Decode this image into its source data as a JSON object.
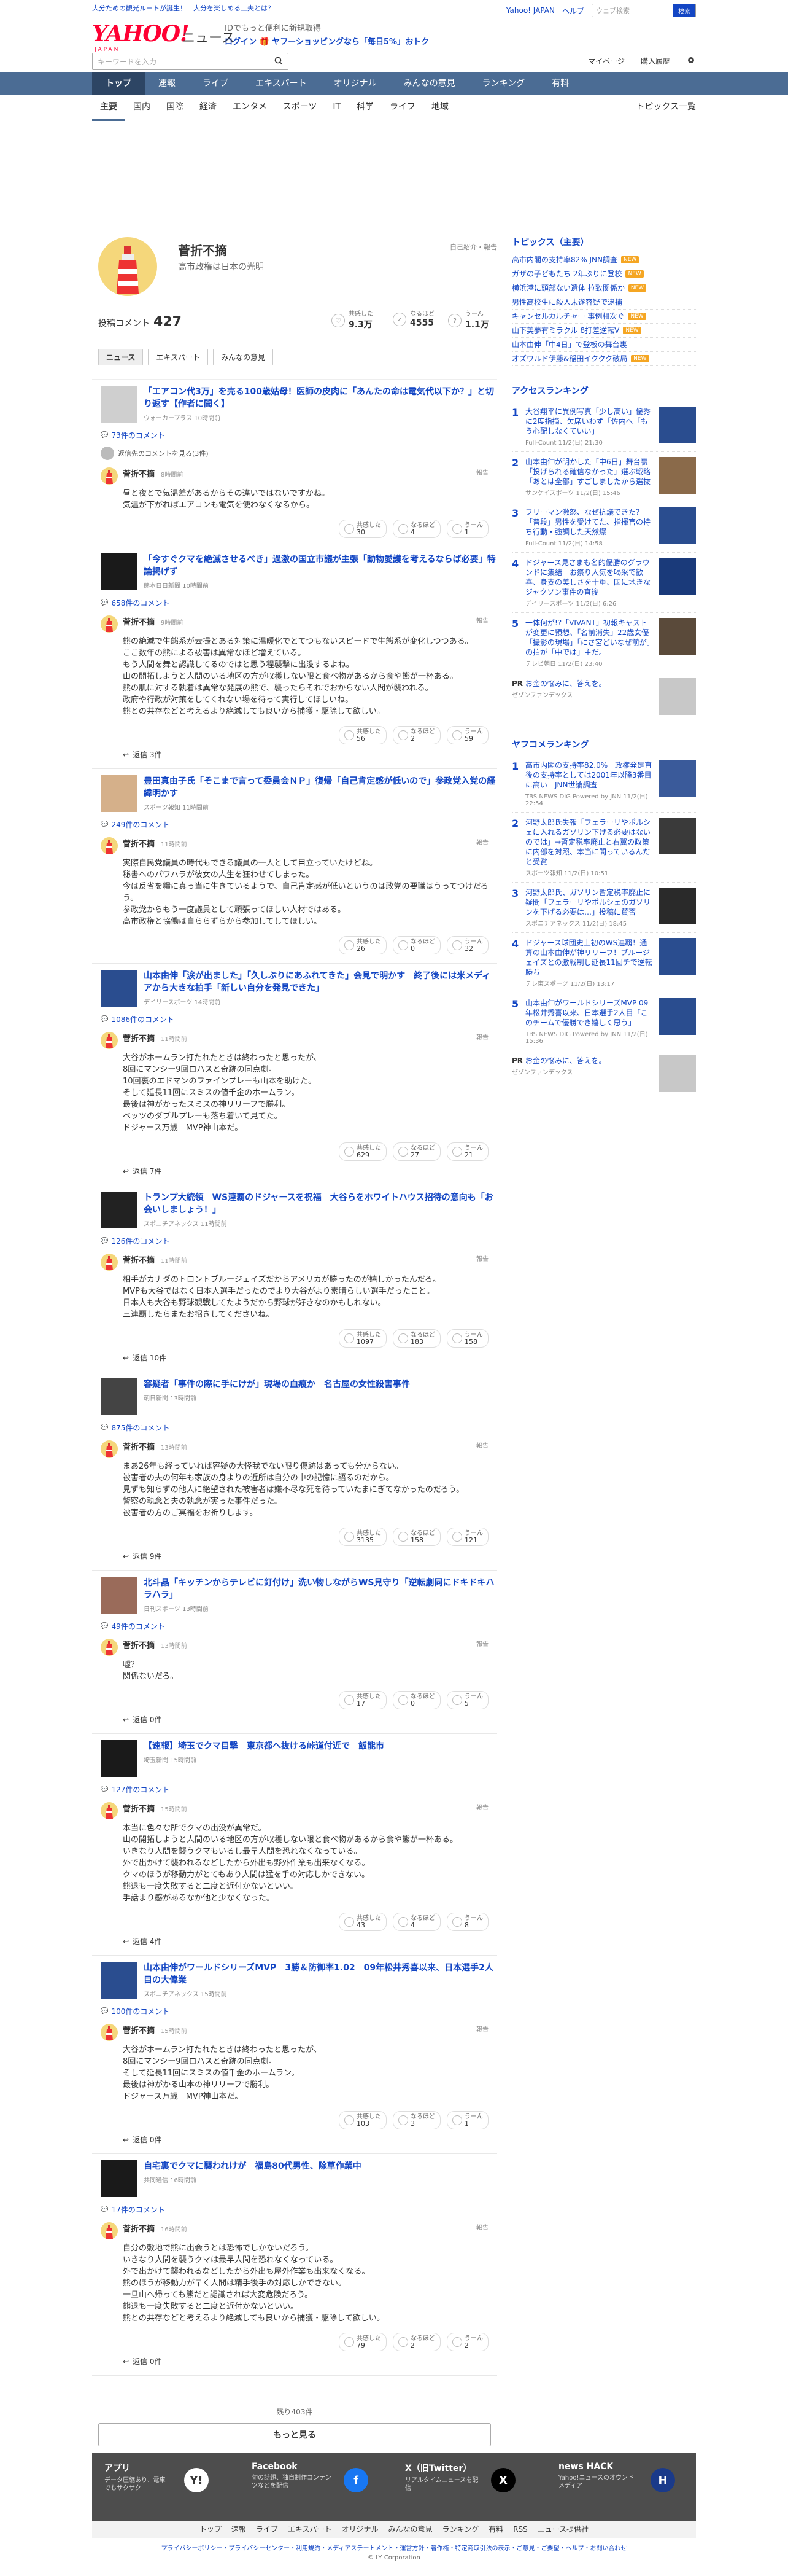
{
  "top_strip": {
    "left": "大分ための観光ルートが誕生！　大分を楽しめる工夫とは？",
    "right_links": [
      "Yahoo! JAPAN",
      "ヘルプ"
    ],
    "search_placeholder": "ウェブ検索",
    "search_button": "検索"
  },
  "masthead": {
    "logo": "YAHOO!",
    "logo_sub": "JAPAN",
    "section": "ニュース",
    "promo_line1": "IDでもっと便利に新規取得",
    "promo_line2": "ログイン 🎁 ヤフーショッピングなら「毎日5%」おトク"
  },
  "search": {
    "placeholder": "キーワードを入力",
    "mypage": "マイページ",
    "history": "購入履歴"
  },
  "global_nav": [
    "トップ",
    "速報",
    "ライブ",
    "エキスパート",
    "オリジナル",
    "みんなの意見",
    "ランキング",
    "有料"
  ],
  "category_nav": [
    "主要",
    "国内",
    "国際",
    "経済",
    "エンタメ",
    "スポーツ",
    "IT",
    "科学",
    "ライフ",
    "地域"
  ],
  "category_nav_right": "トピックス一覧",
  "profile": {
    "name": "菅折不摘",
    "bio": "高市政権は日本の光明",
    "note": "自己紹介・報告",
    "post_count_label": "投稿コメント",
    "post_count": "427",
    "stats": [
      {
        "label": "共感した",
        "value": "9.3万",
        "icon": "♡"
      },
      {
        "label": "なるほど",
        "value": "4555",
        "icon": "✓"
      },
      {
        "label": "うーん",
        "value": "1.1万",
        "icon": "?"
      }
    ],
    "tabs": [
      "ニュース",
      "エキスパート",
      "みんなの意見"
    ]
  },
  "entries": [
    {
      "title": "「エアコン代3万」を売る100歳姑母！医師の皮肉に「あんたの命は電気代以下か？」と切り返す【作者に聞く】",
      "source": "ウォーカープラス 10時間前",
      "comment_count": "73件のコメント",
      "reply_note": "返信先のコメントを見る(3件)",
      "user": "菅折不摘",
      "time": "8時間前",
      "body": "昼と夜とで気温差があるからその違いではないですかね。\n気温が下がればエアコンも電気を使わなくなるから。",
      "empathy": "30",
      "naruhodo": "4",
      "uun": "1",
      "replies": null,
      "thumb": "#cfcfcf"
    },
    {
      "title": "「今すぐクマを絶滅させるべき」過激の国立市議が主張「動物愛護を考えるならば必要」特論掲げず",
      "source": "熊本日日新聞 10時間前",
      "comment_count": "658件のコメント",
      "reply_note": "",
      "user": "菅折不摘",
      "time": "9時間前",
      "body": "熊の絶滅で生態系が云撮とある対策に温暖化でとてつもないスピードで生態系が変化しつつある。\nここ数年の熊による被害は異常なほど増えている。\nもう人間を舞と認識してるのではと思う程襲撃に出没するよね。\n山の開拓しようと人間のいる地区の方が収穫しない限と食べ物があるから食や熊が一杯ある。\n熊の肌に対する執着は異常な発展の熊で、襲ったらそれでおからない人間が襲われる。\n政府や行政が対策をしてくれない場を待って実行してほしいね。\n熊との共存などと考えるより絶滅しても良いから捕獲・駆除して欲しい。",
      "empathy": "56",
      "naruhodo": "2",
      "uun": "59",
      "replies": "返信 3件",
      "thumb": "#1a1a1a"
    },
    {
      "title": "豊田真由子氏「そこまで言って委員会ＮＰ」復帰「自己肯定感が低いので」参政党入党の経緯明かす",
      "source": "スポーツ報知 11時間前",
      "comment_count": "249件のコメント",
      "reply_note": "",
      "user": "菅折不摘",
      "time": "11時間前",
      "body": "実際自民党議員の時代もできる議員の一人として目立っていたけどね。\n秘書へのパワハラが彼女の人生を狂わせてしまった。\n今は反省を糧に真っ当に生きているようで、自己肯定感が低いというのは政党の要職はうってつけだろう。\n参政党からもう一度議員として頑張ってほしい人材ではある。\n高市政権と協働は自ららずらから参加してしてほしい。",
      "empathy": "26",
      "naruhodo": "0",
      "uun": "32",
      "replies": null,
      "thumb": "#d5b08a"
    },
    {
      "title": "山本由伸「涙が出ました」「久しぶりにあふれてきた」会見で明かす　終了後には米メディアから大きな拍手「新しい自分を発見できた」",
      "source": "デイリースポーツ 14時間前",
      "comment_count": "1086件のコメント",
      "reply_note": "",
      "user": "菅折不摘",
      "time": "11時間前",
      "body": "大谷がホームラン打たれたときは終わったと思ったが、\n8回にマンシー9回ロハスと奇跡の同点劇。\n10回裏のエドマンのファインプレーも山本を助けた。\nそして延長11回にスミスの値千金のホームラン。\n最後は神がかったスミスの神リリーフで勝利。\nベッツのダブルプレーも落ち着いて見てた。\nドジャース万歳　MVP神山本だ。",
      "empathy": "629",
      "naruhodo": "27",
      "uun": "21",
      "replies": "返信 7件",
      "thumb": "#2a4d8f"
    },
    {
      "title": "トランプ大統領　WS連覇のドジャースを祝福　大谷らをホワイトハウス招待の意向も「お会いしましょう！」",
      "source": "スポニチアネックス 11時間前",
      "comment_count": "126件のコメント",
      "reply_note": "",
      "user": "菅折不摘",
      "time": "11時間前",
      "body": "相手がカナダのトロントブルージェイズだからアメリカが勝ったのが嬉しかったんだろ。\nMVPも大谷ではなく日本人選手だったのでより大谷がより素晴らしい選手だったこと。\n日本人も大谷も野球観戦してたようだから野球が好きなのかもしれない。\n三連覇したらまたお招きしてくださいね。",
      "empathy": "1097",
      "naruhodo": "183",
      "uun": "158",
      "replies": "返信 10件",
      "thumb": "#222222"
    },
    {
      "title": "容疑者「事件の際に手にけが」現場の血痕か　名古屋の女性殺害事件",
      "source": "朝日新聞 13時間前",
      "comment_count": "875件のコメント",
      "reply_note": "",
      "user": "菅折不摘",
      "time": "13時間前",
      "body": "まあ26年も経っていれば容疑の大怪我でない限り傷跡はあっても分からない。\n被害者の夫の何年も家族の身よりの近所は自分の中の記憶に語るのだから。\n見ずも知らずの他人に絶望された被害者は嫌不尽な死を待っていたまにぎてなかったのだろう。\n警察の執念と夫の執念が実った事件だった。\n被害者の方のご冥福をお祈りします。",
      "empathy": "3135",
      "naruhodo": "158",
      "uun": "121",
      "replies": "返信 9件",
      "thumb": "#444444"
    },
    {
      "title": "北斗晶「キッチンからテレビに釘付け」洗い物しながらWS見守り「逆転劇同にドキドキハラハラ」",
      "source": "日刊スポーツ 13時間前",
      "comment_count": "49件のコメント",
      "reply_note": "",
      "user": "菅折不摘",
      "time": "13時間前",
      "body": "嘘？\n関係ないだろ。",
      "empathy": "17",
      "naruhodo": "0",
      "uun": "5",
      "replies": "返信 0件",
      "thumb": "#9a6b5a"
    },
    {
      "title": "【速報】埼玉でクマ目撃　東京都へ抜ける峠道付近で　飯能市",
      "source": "埼玉新聞 15時間前",
      "comment_count": "127件のコメント",
      "reply_note": "",
      "user": "菅折不摘",
      "time": "15時間前",
      "body": "本当に色々な所でクマの出没が異常だ。\n山の開拓しようと人間のいる地区の方が収穫しない限と食べ物があるから食や熊が一杯ある。\nいきなり人間を襲うクマもいるし最早人間を恐れなくなっている。\n外で出かけて襲われるなどしたから外出も野外作業も出来なくなる。\nクマのほうが移動力がとてもあり人間は猛を手の対応しかできない。\n熊退も一度失敗すると二度と近付かないといい。\n手話まり感があるなか他と少なくなった。",
      "empathy": "43",
      "naruhodo": "4",
      "uun": "8",
      "replies": "返信 4件",
      "thumb": "#1a1a1a"
    },
    {
      "title": "山本由伸がワールドシリーズMVP　3勝＆防御率1.02　09年松井秀喜以来、日本選手2人目の大偉業",
      "source": "スポニチアネックス 15時間前",
      "comment_count": "100件のコメント",
      "reply_note": "",
      "user": "菅折不摘",
      "time": "15時間前",
      "body": "大谷がホームラン打たれたときは終わったと思ったが、\n8回にマンシー9回ロハスと奇跡の同点劇。\nそして延長11回にスミスの値千金のホームラン。\n最後は神がかる山本の神リリーフで勝利。\nドジャース万歳　MVP神山本だ。",
      "empathy": "103",
      "naruhodo": "3",
      "uun": "1",
      "replies": "返信 0件",
      "thumb": "#2a4d8f"
    },
    {
      "title": "自宅裏でクマに襲われけが　福島80代男性、除草作業中",
      "source": "共同通信 16時間前",
      "comment_count": "17件のコメント",
      "reply_note": "",
      "user": "菅折不摘",
      "time": "16時間前",
      "body": "自分の敷地で熊に出会うとは恐怖でしかないだろう。\nいきなり人間を襲うクマは最早人間を恐れなくなっている。\n外で出かけて襲われるなどしたから外出も屋外作業も出来なくなる。\n熊のほうが移動力が早く人間は精手後手の対応しかできない。\n一旦山へ帰っても熊だと認識されば大変危険だろう。\n熊退も一度失敗すると二度と近付かないといい。\n熊との共存などと考えるより絶滅しても良いから捕獲・駆除して欲しい。",
      "empathy": "79",
      "naruhodo": "2",
      "uun": "2",
      "replies": "返信 0件",
      "thumb": "#1a1a1a"
    }
  ],
  "more": {
    "remaining": "残り403件",
    "button": "もっと見る"
  },
  "side": {
    "topics_heading": "トピックス（主要）",
    "topics": [
      {
        "t": "高市内閣の支持率82% JNN調査",
        "b": "NEW"
      },
      {
        "t": "ガザの子どもたち 2年ぶりに登校",
        "b": "NEW"
      },
      {
        "t": "横浜港に頭部ない遺体 拉致関係か",
        "b": "NEW"
      },
      {
        "t": "男性高校生に殺人未遂容疑で逮捕",
        "b": ""
      },
      {
        "t": "キャンセルカルチャー 事例相次ぐ",
        "b": "NEW"
      },
      {
        "t": "山下美夢有ミラクル 8打差逆転V",
        "b": "NEW"
      },
      {
        "t": "山本由伸「中4日」で登板の舞台裏",
        "b": ""
      },
      {
        "t": "オズワルド伊藤&稲田イククク破局",
        "b": "NEW"
      }
    ],
    "access_heading": "アクセスランキング",
    "access": [
      {
        "n": "1",
        "t": "大谷翔平に異例写真「少し高い」優秀に2度指摘、欠席いわず「佐内へ「もう心配しなくていい」",
        "s": "Full-Count 11/2(日) 21:30",
        "img": "#2a4d8f"
      },
      {
        "n": "2",
        "t": "山本由伸が明かした「中6日」舞台裏「投げられる確信なかった」選ぶ戦略「あとは全部」すごしましたから選抜",
        "s": "サンケイスポーツ 11/2(日) 15:46",
        "img": "#8a6a4a"
      },
      {
        "n": "3",
        "t": "フリーマン激怒、なぜ抗議できた？「普段」男性を受けてた、指揮官の持ち行動・強調した天然爆",
        "s": "Full-Count 11/2(日) 14:58",
        "img": "#2a4d8f"
      },
      {
        "n": "4",
        "t": "ドジャース見さまも名的優勝のグラウンドに集結　お祭り人気を喝采で歓喜、身支の美しさを十重、国に地きなジャクソン事件の直後",
        "s": "デイリースポーツ 11/2(日) 6:26",
        "img": "#1a3a7a"
      },
      {
        "n": "5",
        "t": "一体何が!?「VIVANT」初報キャストが変更に預想、「名前消失」22歳女優「撮影の現場」「にさ宮どいなぜ前が」の拍が「中では」主だ。",
        "s": "テレビ朝日 11/2(日) 23:40",
        "img": "#5a4a3a"
      }
    ],
    "pr1_tag": "PR",
    "pr1_text": "お金の悩みに、答えを。",
    "pr1_src": "ゼゾンファンデックス",
    "yahoo_heading": "ヤフコメランキング",
    "yahoo": [
      {
        "n": "1",
        "t": "高市内閣の支持率82.0%　政権発足直後の支持率としては2001年以降3番目に高い　JNN世論調査",
        "s": "TBS NEWS DIG Powered by JNN 11/2(日) 22:54",
        "img": "#3a5a9a"
      },
      {
        "n": "2",
        "t": "河野太郎氏失報「フェラーリやポルシェに入れるガソリン下げる必要はないのでは」→暫定税率廃止と右翼の政策に内部を対照、本当に問っているんだと受賞",
        "s": "スポーツ報知 11/2(日) 10:51",
        "img": "#3a3a3a"
      },
      {
        "n": "3",
        "t": "河野太郎氏、ガソリン暫定税率廃止に疑問「フェラーリやポルシェのガソリンを下げる必要は…」投稿に賛否",
        "s": "スポニチアネックス 11/2(日) 18:45",
        "img": "#2a2a2a"
      },
      {
        "n": "4",
        "t": "ドジャース球団史上初のWS連覇！通算の山本由伸が神リリーフ！ブルージェイズとの激戦制し延長11回チで逆転勝ち",
        "s": "テレ東スポーツ 11/2(日) 13:17",
        "img": "#2a4d8f"
      },
      {
        "n": "5",
        "t": "山本由伸がワールドシリーズMVP 09年松井秀喜以来、日本選手2人目「このチームで優勝でき嬉しく思う」",
        "s": "TBS NEWS DIG Powered by JNN 11/2(日) 15:36",
        "img": "#2a4d8f"
      }
    ],
    "pr2_tag": "PR",
    "pr2_text": "お金の悩みに、答えを。",
    "pr2_src": "ゼゾンファンデックス"
  },
  "footer": {
    "apps": [
      {
        "h": "アプリ",
        "p": "データ圧縮あり、電車でもサクサク",
        "icon": "Y!"
      },
      {
        "h": "Facebook",
        "p": "旬の話題、独自制作コンテンツなどを配信",
        "icon": "f"
      },
      {
        "h": "X（旧Twitter）",
        "p": "リアルタイムニュースを配信",
        "icon": "X"
      },
      {
        "h": "news HACK",
        "p": "Yahoo!ニュースのオウンドメディア",
        "icon": "H"
      }
    ],
    "nav": [
      "トップ",
      "速報",
      "ライブ",
      "エキスパート",
      "オリジナル",
      "みんなの意見",
      "ランキング",
      "有料",
      "RSS",
      "ニュース提供社"
    ],
    "legal": "プライバシーポリシー・プライバシーセンター・利用規約・メディアステートメント・運営方針・著作権・特定商取引法の表示・ご意見・ご要望・ヘルプ・お問い合わせ",
    "copy": "© LY Corporation"
  },
  "colors": {
    "nav_bg": "#4b6c94",
    "link": "#1346c4",
    "brand_red": "#ff0033"
  }
}
